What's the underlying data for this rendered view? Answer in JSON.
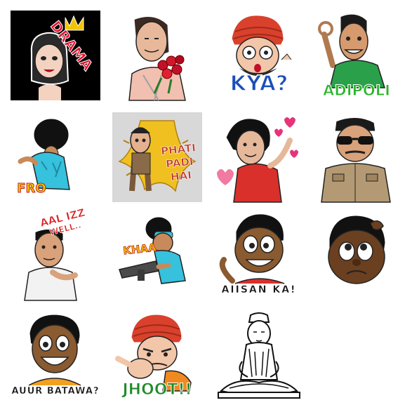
{
  "stickers": [
    {
      "id": "drama",
      "caption": "DRAMA"
    },
    {
      "id": "roses",
      "caption": ""
    },
    {
      "id": "kya",
      "caption": "KYA?"
    },
    {
      "id": "adipoli",
      "caption": "ADIPOLI"
    },
    {
      "id": "fro",
      "caption": "FRO"
    },
    {
      "id": "phati",
      "caption": "PHATI PADI HAI",
      "lines": [
        "PHATI",
        "PADI",
        "HAI"
      ]
    },
    {
      "id": "hearts",
      "caption": ""
    },
    {
      "id": "cop",
      "caption": ""
    },
    {
      "id": "aal-izz-well",
      "caption": "AAL IZZ WELL..",
      "lines": [
        "AAL IZZ",
        "WELL.."
      ]
    },
    {
      "id": "khaa",
      "caption": "KHAA"
    },
    {
      "id": "aiisan-ka",
      "caption": "AIISAN KA!"
    },
    {
      "id": "scratch",
      "caption": ""
    },
    {
      "id": "auur-batawa",
      "caption": "AUUR BATAWA?"
    },
    {
      "id": "jhoot",
      "caption": "JHOOT!!"
    },
    {
      "id": "buddha",
      "caption": ""
    }
  ],
  "colors": {
    "drama_bg": "#000000",
    "drama_text": "#e8102a",
    "kya_text": "#1b4fb8",
    "adipoli_text": "#2bb52b",
    "jhoot_text": "#1f8a2a",
    "fro_text": "#f2c800",
    "phati_text": "#c0392b",
    "phati_bg": "#d8d8d8",
    "turban": "#d9412c",
    "cyan": "#36c1dd"
  }
}
